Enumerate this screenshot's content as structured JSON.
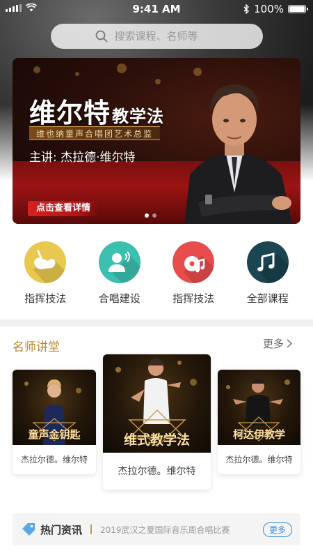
{
  "status": {
    "time": "9:41 AM",
    "battery": "100%"
  },
  "search": {
    "placeholder": "搜索课程、名师等"
  },
  "banner": {
    "title": "维尔特",
    "title_suffix": "教学法",
    "subtitle": "维也纳童声合唱团艺术总监",
    "speaker": "主讲: 杰拉德·维尔特",
    "cta": "点击查看详情",
    "active_dot": 0,
    "dot_count": 2
  },
  "categories": [
    {
      "label": "指挥技法",
      "icon": "conductor-hand-icon",
      "color": "#e8c84f"
    },
    {
      "label": "合唱建设",
      "icon": "person-speaking-icon",
      "color": "#3bbfb0"
    },
    {
      "label": "指挥技法",
      "icon": "cd-music-icon",
      "color": "#e94c4c"
    },
    {
      "label": "全部课程",
      "icon": "music-note-icon",
      "color": "#1b4550"
    }
  ],
  "section": {
    "title": "名师讲堂",
    "more": "更多"
  },
  "cards": [
    {
      "title": "童声金钥匙",
      "name": "杰拉尔德。维尔特"
    },
    {
      "title": "维式教学法",
      "name": "杰拉尔德。维尔特"
    },
    {
      "title": "柯达伊教学",
      "name": "杰拉尔德。维尔特"
    }
  ],
  "news": {
    "title": "热门资讯",
    "text": "2019武汉之夏国际音乐周合唱比赛",
    "more": "更多"
  },
  "colors": {
    "accent_gold": "#b8862c",
    "link_blue": "#3a8fd9"
  }
}
